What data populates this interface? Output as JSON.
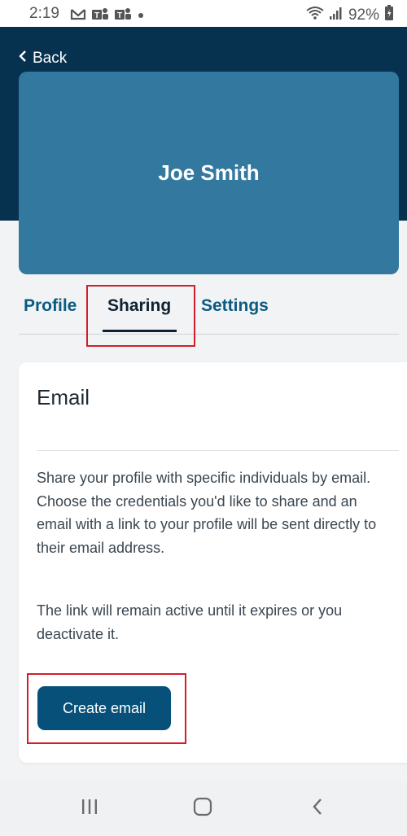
{
  "status_bar": {
    "time": "2:19",
    "battery": "92%",
    "left_icons": [
      "gmail-icon",
      "teams-icon",
      "teams-icon",
      "dot-icon"
    ],
    "right_icons": [
      "wifi-icon",
      "signal-icon",
      "battery-icon"
    ]
  },
  "header": {
    "back_label": "Back"
  },
  "profile": {
    "name": "Joe Smith"
  },
  "tabs": [
    {
      "label": "Profile",
      "active": false
    },
    {
      "label": "Sharing",
      "active": true
    },
    {
      "label": "Settings",
      "active": false
    }
  ],
  "email_section": {
    "title": "Email",
    "description": "Share your profile with specific individuals by email. Choose the credentials you'd like to share and an email with a link to your profile will be sent directly to their email address.",
    "note": "The link will remain active until it expires or you deactivate it.",
    "button_label": "Create email"
  },
  "nav": {
    "icons": [
      "recents-icon",
      "home-icon",
      "back-icon"
    ]
  },
  "colors": {
    "header_band": "#07324f",
    "profile_card": "#33789f",
    "button": "#07507a",
    "highlight": "#d21e2b",
    "tab_link": "#0a5b82"
  }
}
